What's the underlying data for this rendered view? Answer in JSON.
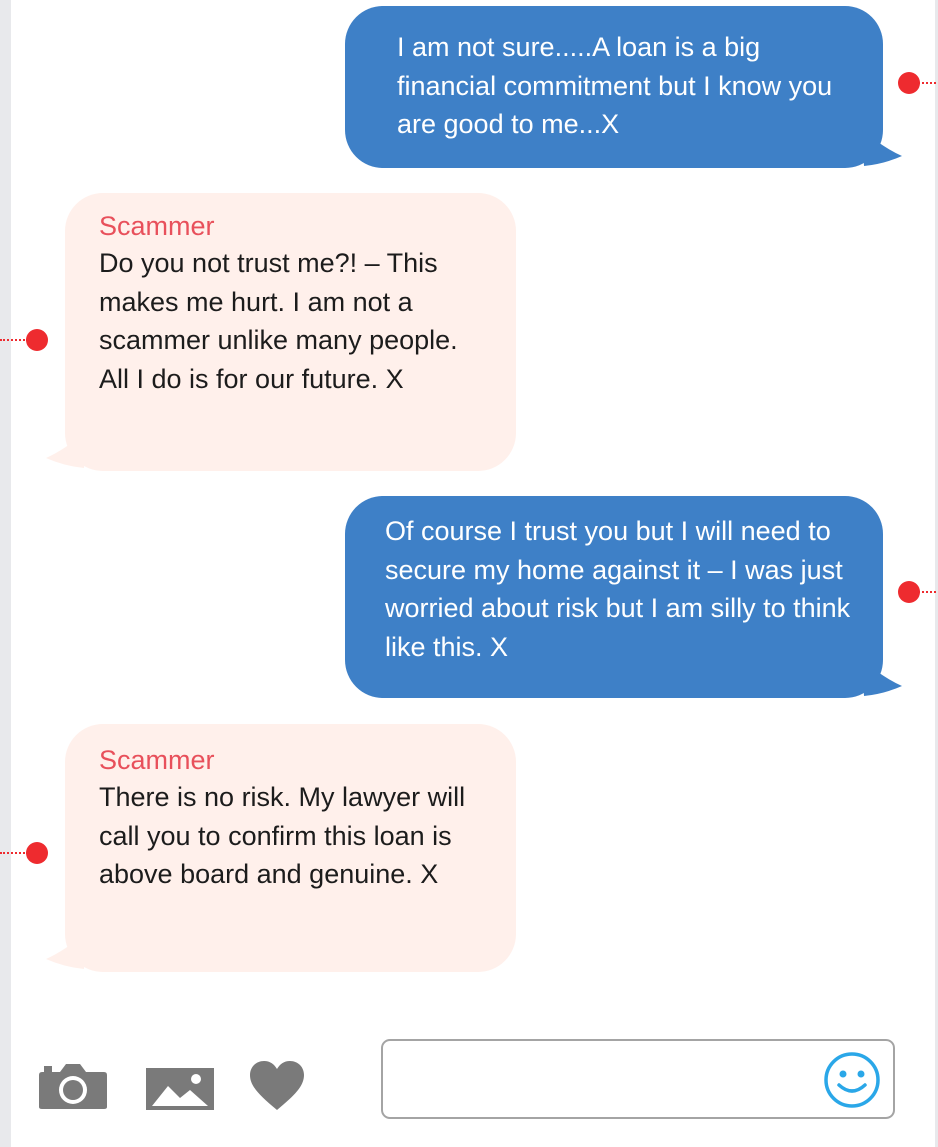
{
  "messages": [
    {
      "from": "me",
      "text": "I am not sure.....A loan is a big financial commitment but I know you are good to me...X"
    },
    {
      "from": "them",
      "sender": "Scammer",
      "text": "Do you not trust me?! – This makes me hurt.  I am not a scammer unlike many people. All I do is for our future. X"
    },
    {
      "from": "me",
      "text": "Of course I trust you but I will need to secure my home against it – I was just worried about risk but I am silly to think like this. X"
    },
    {
      "from": "them",
      "sender": "Scammer",
      "text": "There is no risk. My lawyer will call you to confirm this loan is above board and genuine. X"
    }
  ],
  "composer": {
    "placeholder": "",
    "icons": [
      "camera-icon",
      "image-icon",
      "heart-icon",
      "smiley-icon"
    ]
  },
  "colors": {
    "outgoing_bubble": "#3e80c7",
    "incoming_bubble": "#fff0eb",
    "sender_name": "#e8505b",
    "annotation_dot": "#ee2b2f",
    "icon_gray": "#7a7a7a",
    "emoji_blue": "#2aa7e8"
  }
}
